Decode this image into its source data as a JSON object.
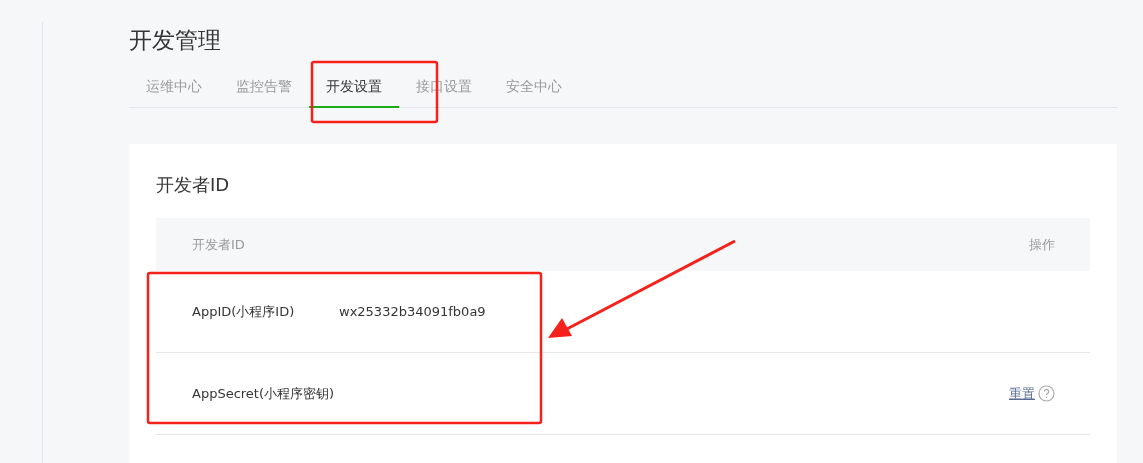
{
  "page_title": "开发管理",
  "tabs": [
    {
      "label": "运维中心",
      "selected": false
    },
    {
      "label": "监控告警",
      "selected": false
    },
    {
      "label": "开发设置",
      "selected": true
    },
    {
      "label": "接口设置",
      "selected": false
    },
    {
      "label": "安全中心",
      "selected": false
    }
  ],
  "section": {
    "title": "开发者ID",
    "table": {
      "columns": [
        "开发者ID",
        "操作"
      ],
      "rows": [
        {
          "label": "AppID(小程序ID)",
          "value": "wx25332b34091fb0a9"
        },
        {
          "label": "AppSecret(小程序密钥)",
          "action": "重置"
        }
      ]
    }
  }
}
